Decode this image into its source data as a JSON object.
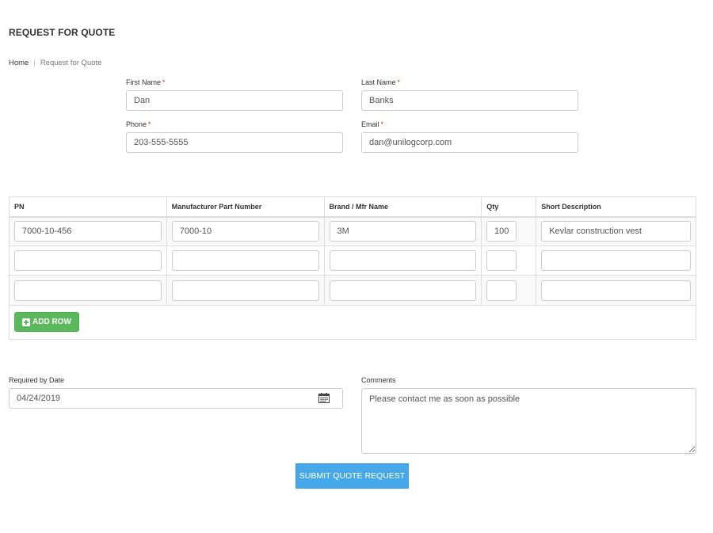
{
  "page": {
    "title": "REQUEST FOR QUOTE"
  },
  "breadcrumb": {
    "home": "Home",
    "separator": "|",
    "current": "Request for Quote"
  },
  "contact": {
    "first_name": {
      "label": "First Name",
      "required_mark": "*",
      "value": "Dan"
    },
    "last_name": {
      "label": "Last Name",
      "required_mark": "*",
      "value": "Banks"
    },
    "phone": {
      "label": "Phone",
      "required_mark": "*",
      "value": "203-555-5555"
    },
    "email": {
      "label": "Email",
      "required_mark": "*",
      "value": "dan@unilogcorp.com"
    }
  },
  "parts_table": {
    "headers": [
      "PN",
      "Manufacturer Part Number",
      "Brand / Mfr Name",
      "Qty",
      "Short Description"
    ],
    "rows": [
      [
        "7000-10-456",
        "7000-10",
        "3M",
        "100",
        "Kevlar construction vest"
      ],
      [
        "",
        "",
        "",
        "",
        ""
      ],
      [
        "",
        "",
        "",
        "",
        ""
      ]
    ],
    "add_row_label": "ADD ROW"
  },
  "required_by": {
    "label": "Required by Date",
    "value": "04/24/2019",
    "icon": "calendar-icon"
  },
  "comments": {
    "label": "Comments",
    "value": "Please contact me as soon as possible"
  },
  "submit_label": "SUBMIT QUOTE REQUEST",
  "colors": {
    "add_row": "#5cb85c",
    "submit": "#46a8e8",
    "required_mark": "#c9302c"
  }
}
